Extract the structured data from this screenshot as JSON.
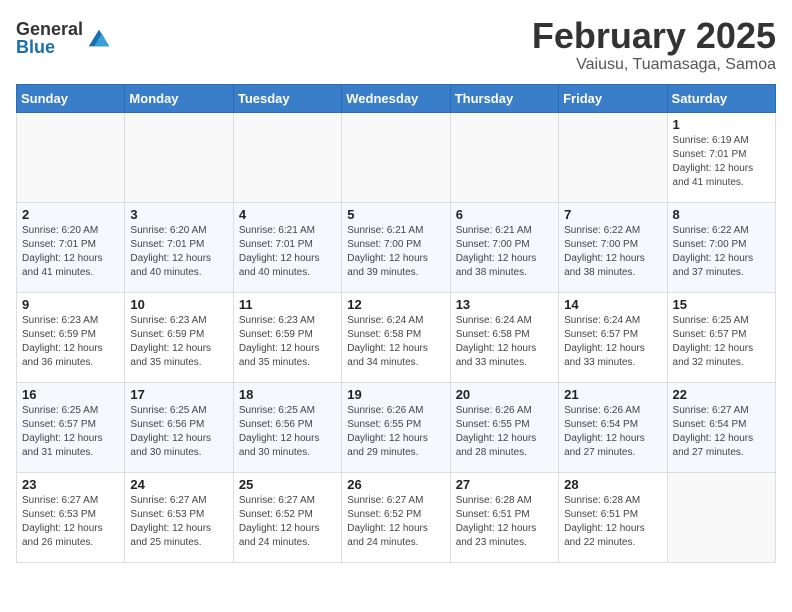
{
  "logo": {
    "general": "General",
    "blue": "Blue"
  },
  "title": "February 2025",
  "subtitle": "Vaiusu, Tuamasaga, Samoa",
  "days_of_week": [
    "Sunday",
    "Monday",
    "Tuesday",
    "Wednesday",
    "Thursday",
    "Friday",
    "Saturday"
  ],
  "weeks": [
    [
      {
        "day": "",
        "info": ""
      },
      {
        "day": "",
        "info": ""
      },
      {
        "day": "",
        "info": ""
      },
      {
        "day": "",
        "info": ""
      },
      {
        "day": "",
        "info": ""
      },
      {
        "day": "",
        "info": ""
      },
      {
        "day": "1",
        "info": "Sunrise: 6:19 AM\nSunset: 7:01 PM\nDaylight: 12 hours and 41 minutes."
      }
    ],
    [
      {
        "day": "2",
        "info": "Sunrise: 6:20 AM\nSunset: 7:01 PM\nDaylight: 12 hours and 41 minutes."
      },
      {
        "day": "3",
        "info": "Sunrise: 6:20 AM\nSunset: 7:01 PM\nDaylight: 12 hours and 40 minutes."
      },
      {
        "day": "4",
        "info": "Sunrise: 6:21 AM\nSunset: 7:01 PM\nDaylight: 12 hours and 40 minutes."
      },
      {
        "day": "5",
        "info": "Sunrise: 6:21 AM\nSunset: 7:00 PM\nDaylight: 12 hours and 39 minutes."
      },
      {
        "day": "6",
        "info": "Sunrise: 6:21 AM\nSunset: 7:00 PM\nDaylight: 12 hours and 38 minutes."
      },
      {
        "day": "7",
        "info": "Sunrise: 6:22 AM\nSunset: 7:00 PM\nDaylight: 12 hours and 38 minutes."
      },
      {
        "day": "8",
        "info": "Sunrise: 6:22 AM\nSunset: 7:00 PM\nDaylight: 12 hours and 37 minutes."
      }
    ],
    [
      {
        "day": "9",
        "info": "Sunrise: 6:23 AM\nSunset: 6:59 PM\nDaylight: 12 hours and 36 minutes."
      },
      {
        "day": "10",
        "info": "Sunrise: 6:23 AM\nSunset: 6:59 PM\nDaylight: 12 hours and 35 minutes."
      },
      {
        "day": "11",
        "info": "Sunrise: 6:23 AM\nSunset: 6:59 PM\nDaylight: 12 hours and 35 minutes."
      },
      {
        "day": "12",
        "info": "Sunrise: 6:24 AM\nSunset: 6:58 PM\nDaylight: 12 hours and 34 minutes."
      },
      {
        "day": "13",
        "info": "Sunrise: 6:24 AM\nSunset: 6:58 PM\nDaylight: 12 hours and 33 minutes."
      },
      {
        "day": "14",
        "info": "Sunrise: 6:24 AM\nSunset: 6:57 PM\nDaylight: 12 hours and 33 minutes."
      },
      {
        "day": "15",
        "info": "Sunrise: 6:25 AM\nSunset: 6:57 PM\nDaylight: 12 hours and 32 minutes."
      }
    ],
    [
      {
        "day": "16",
        "info": "Sunrise: 6:25 AM\nSunset: 6:57 PM\nDaylight: 12 hours and 31 minutes."
      },
      {
        "day": "17",
        "info": "Sunrise: 6:25 AM\nSunset: 6:56 PM\nDaylight: 12 hours and 30 minutes."
      },
      {
        "day": "18",
        "info": "Sunrise: 6:25 AM\nSunset: 6:56 PM\nDaylight: 12 hours and 30 minutes."
      },
      {
        "day": "19",
        "info": "Sunrise: 6:26 AM\nSunset: 6:55 PM\nDaylight: 12 hours and 29 minutes."
      },
      {
        "day": "20",
        "info": "Sunrise: 6:26 AM\nSunset: 6:55 PM\nDaylight: 12 hours and 28 minutes."
      },
      {
        "day": "21",
        "info": "Sunrise: 6:26 AM\nSunset: 6:54 PM\nDaylight: 12 hours and 27 minutes."
      },
      {
        "day": "22",
        "info": "Sunrise: 6:27 AM\nSunset: 6:54 PM\nDaylight: 12 hours and 27 minutes."
      }
    ],
    [
      {
        "day": "23",
        "info": "Sunrise: 6:27 AM\nSunset: 6:53 PM\nDaylight: 12 hours and 26 minutes."
      },
      {
        "day": "24",
        "info": "Sunrise: 6:27 AM\nSunset: 6:53 PM\nDaylight: 12 hours and 25 minutes."
      },
      {
        "day": "25",
        "info": "Sunrise: 6:27 AM\nSunset: 6:52 PM\nDaylight: 12 hours and 24 minutes."
      },
      {
        "day": "26",
        "info": "Sunrise: 6:27 AM\nSunset: 6:52 PM\nDaylight: 12 hours and 24 minutes."
      },
      {
        "day": "27",
        "info": "Sunrise: 6:28 AM\nSunset: 6:51 PM\nDaylight: 12 hours and 23 minutes."
      },
      {
        "day": "28",
        "info": "Sunrise: 6:28 AM\nSunset: 6:51 PM\nDaylight: 12 hours and 22 minutes."
      },
      {
        "day": "",
        "info": ""
      }
    ]
  ]
}
